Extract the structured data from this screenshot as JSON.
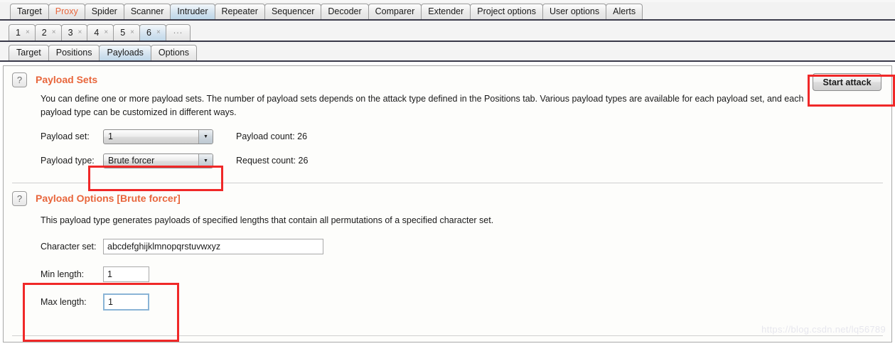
{
  "window": {
    "top_tabs": [
      {
        "label": "Target",
        "selected": false,
        "accent": false
      },
      {
        "label": "Proxy",
        "selected": false,
        "accent": true
      },
      {
        "label": "Spider",
        "selected": false,
        "accent": false
      },
      {
        "label": "Scanner",
        "selected": false,
        "accent": false
      },
      {
        "label": "Intruder",
        "selected": true,
        "accent": false
      },
      {
        "label": "Repeater",
        "selected": false,
        "accent": false
      },
      {
        "label": "Sequencer",
        "selected": false,
        "accent": false
      },
      {
        "label": "Decoder",
        "selected": false,
        "accent": false
      },
      {
        "label": "Comparer",
        "selected": false,
        "accent": false
      },
      {
        "label": "Extender",
        "selected": false,
        "accent": false
      },
      {
        "label": "Project options",
        "selected": false,
        "accent": false
      },
      {
        "label": "User options",
        "selected": false,
        "accent": false
      },
      {
        "label": "Alerts",
        "selected": false,
        "accent": false
      }
    ],
    "attack_tabs": [
      {
        "label": "1",
        "close": "×",
        "selected": false
      },
      {
        "label": "2",
        "close": "×",
        "selected": false
      },
      {
        "label": "3",
        "close": "×",
        "selected": false
      },
      {
        "label": "4",
        "close": "×",
        "selected": false
      },
      {
        "label": "5",
        "close": "×",
        "selected": false
      },
      {
        "label": "6",
        "close": "×",
        "selected": true
      }
    ],
    "attack_tabs_more": "...",
    "inner_tabs": [
      {
        "label": "Target",
        "selected": false
      },
      {
        "label": "Positions",
        "selected": false
      },
      {
        "label": "Payloads",
        "selected": true
      },
      {
        "label": "Options",
        "selected": false
      }
    ]
  },
  "toolbar": {
    "start_attack_label": "Start attack"
  },
  "payload_sets": {
    "help_icon": "?",
    "title": "Payload Sets",
    "description": "You can define one or more payload sets. The number of payload sets depends on the attack type defined in the Positions tab. Various payload types are available for each payload set, and each payload type can be customized in different ways.",
    "payload_set_label": "Payload set:",
    "payload_set_value": "1",
    "payload_type_label": "Payload type:",
    "payload_type_value": "Brute forcer",
    "payload_count_label": "Payload count:  26",
    "request_count_label": "Request count: 26",
    "dropdown_arrow": "▼"
  },
  "payload_options": {
    "help_icon": "?",
    "title": "Payload Options [Brute forcer]",
    "description": "This payload type generates payloads of specified lengths that contain all permutations of a specified character set.",
    "character_set_label": "Character set:",
    "character_set_value": "abcdefghijklmnopqrstuvwxyz",
    "min_length_label": "Min length:",
    "min_length_value": "1",
    "max_length_label": "Max length:",
    "max_length_value": "1"
  },
  "watermark": {
    "text": "https://blog.csdn.net/lq56789"
  },
  "colors": {
    "accent_orange": "#e8663c",
    "annotation_red": "#f02828",
    "selected_tab_blue": "#c1d8e9"
  }
}
